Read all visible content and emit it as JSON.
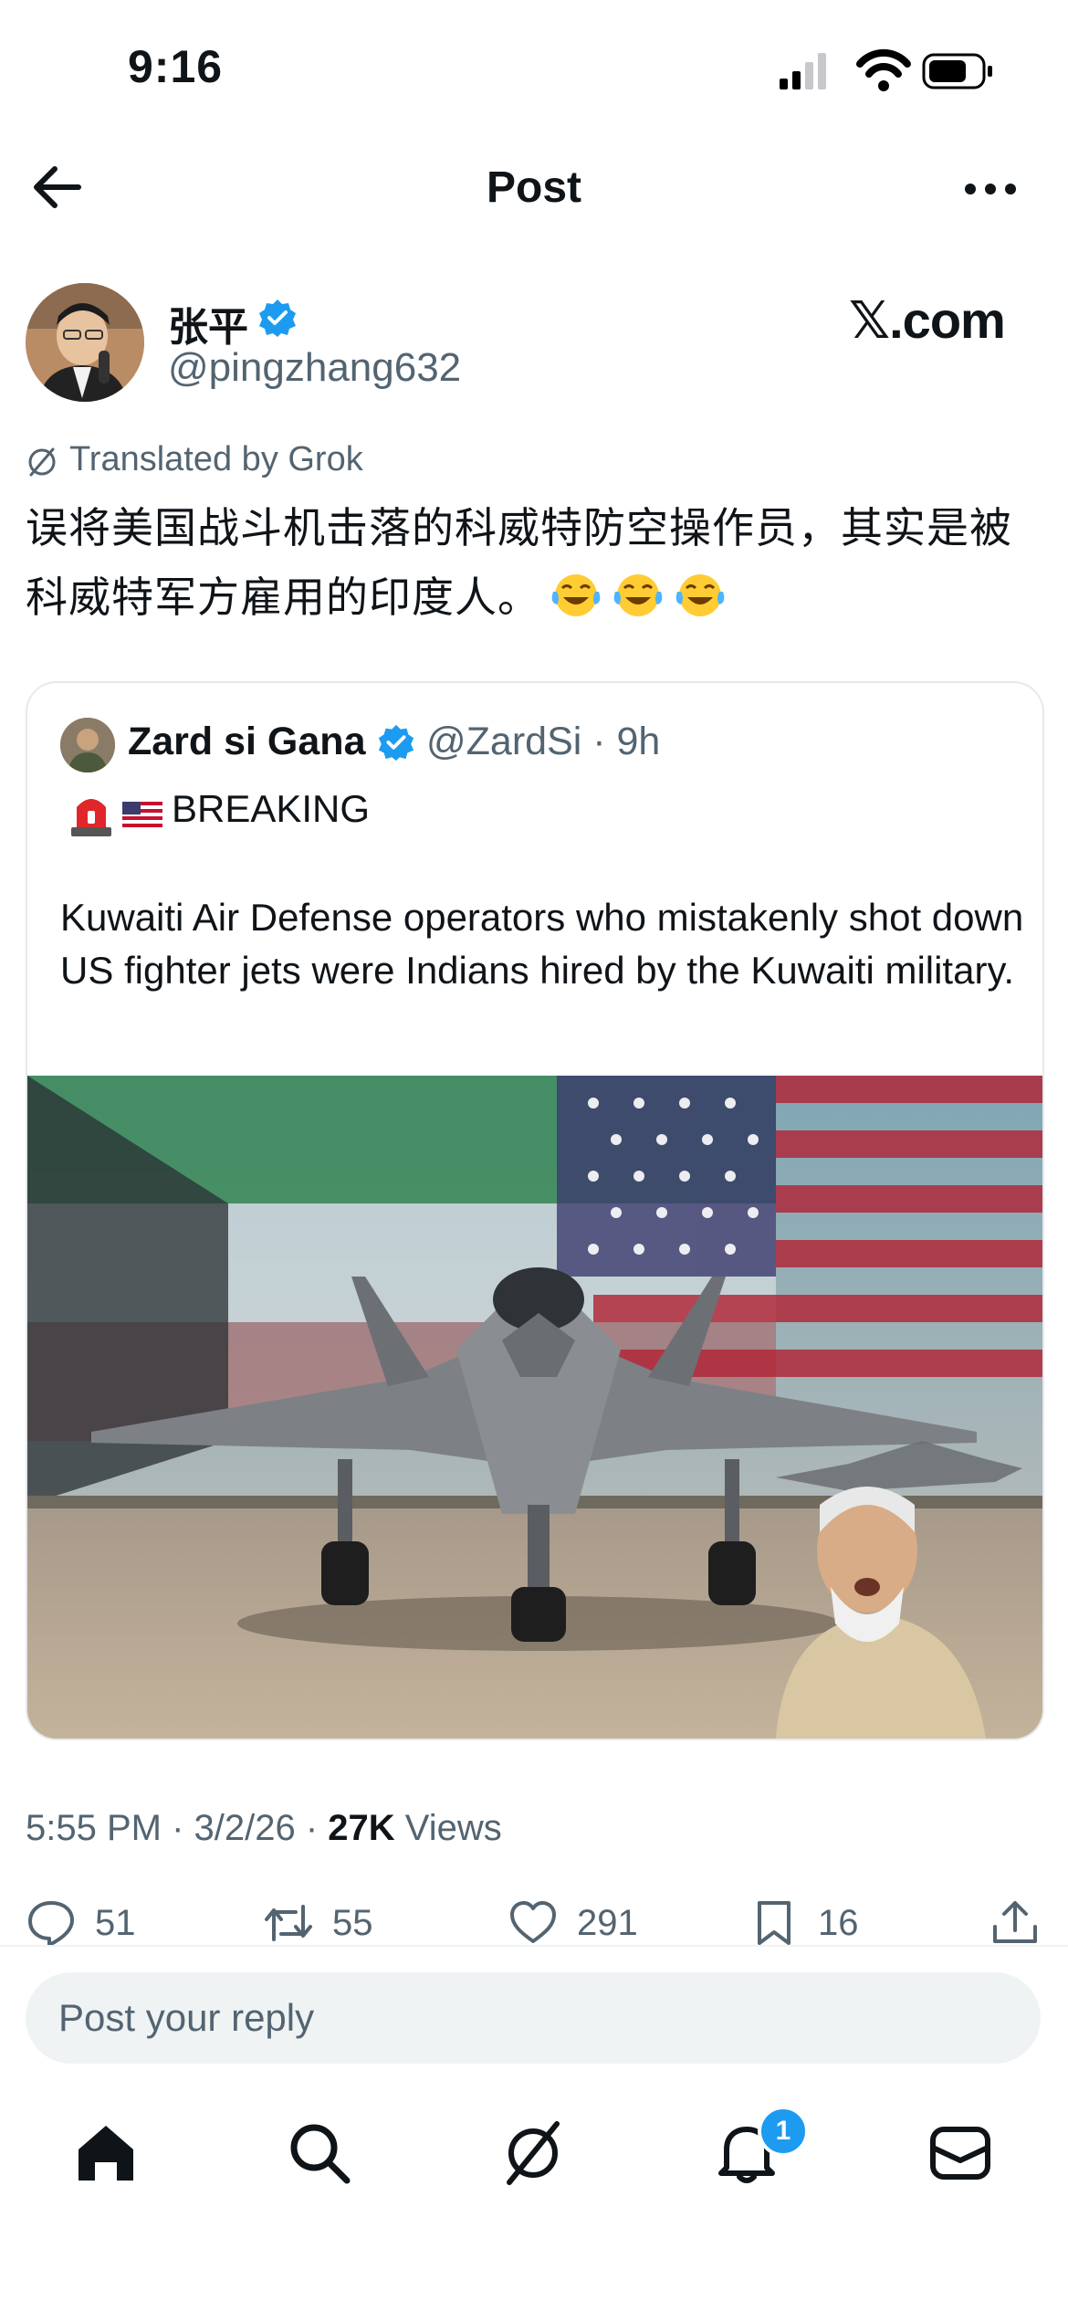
{
  "status_bar": {
    "time": "9:16"
  },
  "header": {
    "title": "Post"
  },
  "author": {
    "name": "张平",
    "handle": "@pingzhang632",
    "watermark": "𝕏.com"
  },
  "translation": {
    "label": "Translated by Grok"
  },
  "tweet": {
    "text": "误将美国战斗机击落的科威特防空操作员，其实是被科威特军方雇用的印度人。",
    "emoji": "face-with-tears-of-joy"
  },
  "quote": {
    "name": "Zard si Gana",
    "handle_time": "@ZardSi · 9h",
    "breaking": "BREAKING",
    "text": "Kuwaiti Air Defense operators who mistakenly shot down US fighter jets were Indians hired by the Kuwaiti military."
  },
  "meta": {
    "time_date": "5:55 PM · 3/2/26 · ",
    "views_count": "27K",
    "views_label": " Views"
  },
  "actions": {
    "replies": "51",
    "reposts": "55",
    "likes": "291",
    "bookmarks": "16"
  },
  "reply": {
    "placeholder": "Post your reply"
  },
  "nav": {
    "notification_count": "1"
  },
  "colors": {
    "accent": "#1d9bf0",
    "text": "#0f1419",
    "muted": "#536471"
  }
}
